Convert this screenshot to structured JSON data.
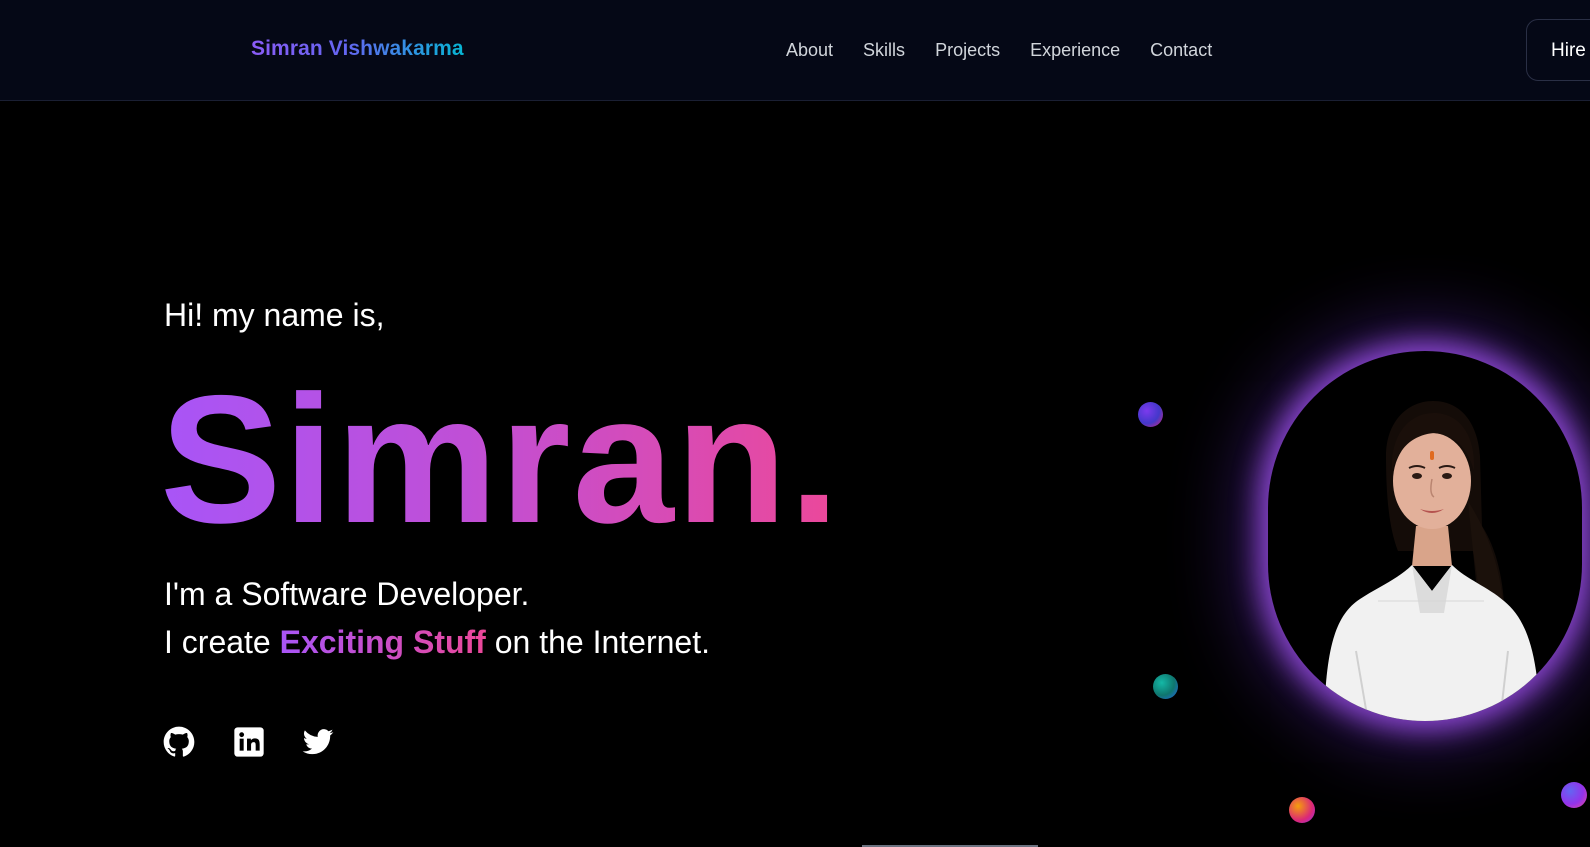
{
  "nav": {
    "logo": "Simran Vishwakarma",
    "links": [
      "About",
      "Skills",
      "Projects",
      "Experience",
      "Contact"
    ],
    "cta_label": "Hire"
  },
  "hero": {
    "greeting": "Hi! my name is,",
    "name": "Simran.",
    "line1": "I'm a Software Developer.",
    "line2_prefix": "I create ",
    "line2_highlight": "Exciting Stuff",
    "line2_suffix": " on the Internet.",
    "socials": [
      "github-icon",
      "linkedin-icon",
      "twitter-icon"
    ]
  },
  "colors": {
    "nav_background": "#050816",
    "page_background": "#000000",
    "accent_purple": "#a855f7",
    "accent_pink": "#ec4899",
    "logo_cyan": "#06b6d4",
    "glow": "#a855f7"
  }
}
